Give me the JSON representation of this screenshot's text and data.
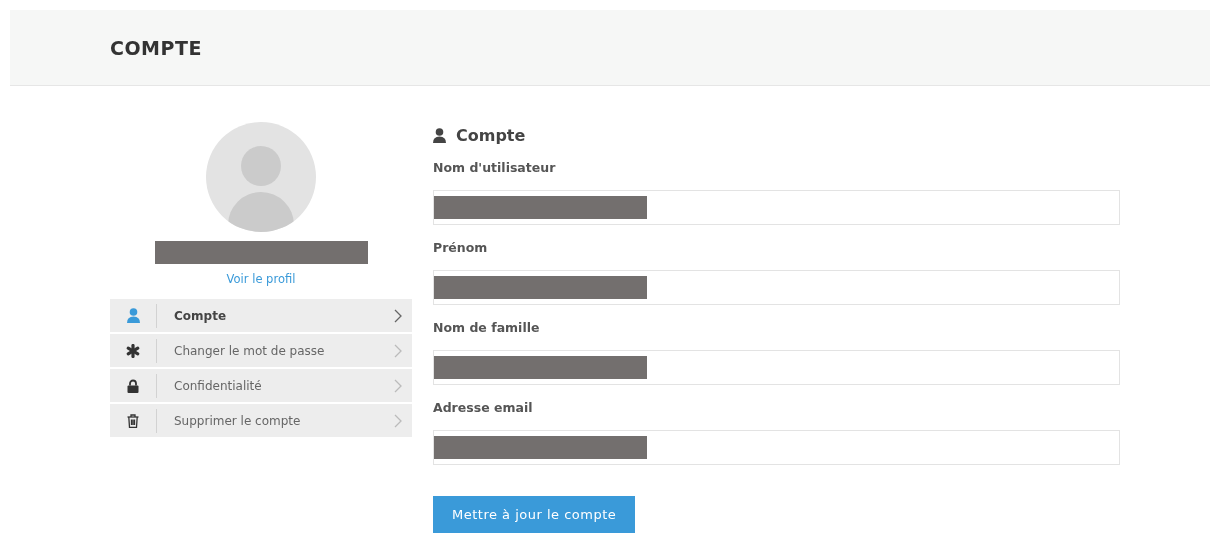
{
  "header": {
    "title": "COMPTE"
  },
  "profile": {
    "name_redacted": true,
    "link": "Voir le profil"
  },
  "menu": [
    {
      "label": "Compte",
      "selected": true
    },
    {
      "label": "Changer le mot de passe",
      "selected": false
    },
    {
      "label": "Confidentialité",
      "selected": false
    },
    {
      "label": "Supprimer le compte",
      "selected": false
    }
  ],
  "form": {
    "title": "Compte",
    "fields": [
      {
        "label": "Nom d'utilisateur",
        "redacted": true
      },
      {
        "label": "Prénom",
        "redacted": true
      },
      {
        "label": "Nom de famille",
        "redacted": true
      },
      {
        "label": "Adresse email",
        "redacted": true
      }
    ],
    "submit": "Mettre à jour le compte"
  }
}
